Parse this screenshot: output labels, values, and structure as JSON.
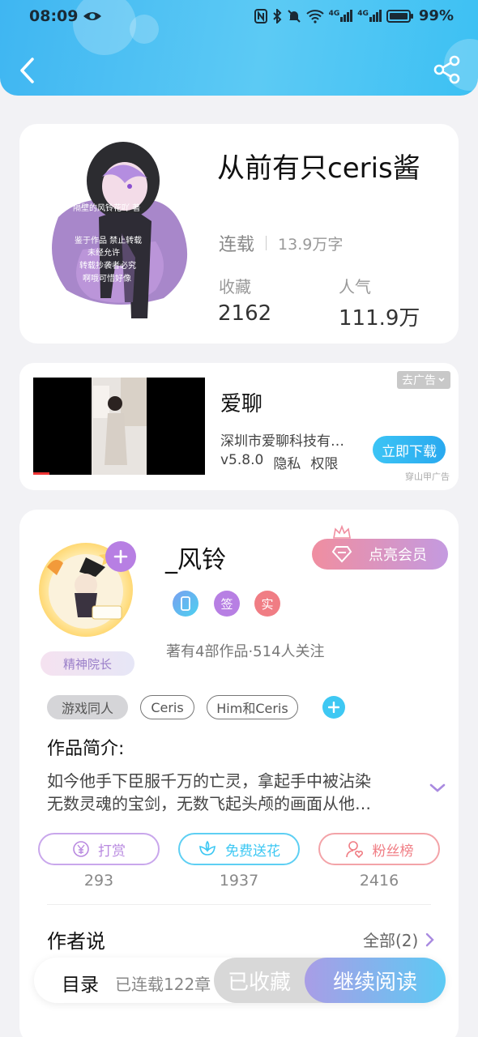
{
  "status_bar": {
    "time": "08:09",
    "battery": "99%",
    "network_1": "4G",
    "network_2": "4G"
  },
  "header": {
    "back_icon": "chevron-left-icon",
    "share_icon": "share-icon"
  },
  "book": {
    "title": "从前有只ceris酱",
    "status": "连载",
    "word_count": "13.9万字",
    "favorites_label": "收藏",
    "favorites_value": "2162",
    "popularity_label": "人气",
    "popularity_value": "111.9万",
    "cover_caption_1": "隔壁的风铃花吖 著",
    "cover_caption_2": "鉴于作品 禁止转载",
    "cover_caption_3": "未经允许",
    "cover_caption_4": "转载抄袭者必究",
    "cover_caption_5": "啊哦可惜好像"
  },
  "ad": {
    "app_name": "爱聊",
    "company": "深圳市爱聊科技有…",
    "version": "v5.8.0",
    "privacy": "隐私",
    "permissions": "权限",
    "close_label": "去广告",
    "download_label": "立即下载",
    "source": "穿山甲广告"
  },
  "author": {
    "name": "_风铃",
    "title_badge": "精神院长",
    "vip_label": "点亮会员",
    "badge_sign": "签",
    "badge_real": "实",
    "works_info": "著有4部作品·514人关注",
    "colors": {
      "vip": "#f08ea0",
      "sign": "#b77fe3",
      "real": "#f07d84"
    }
  },
  "tags": [
    "游戏同人",
    "Ceris",
    "Him和Ceris"
  ],
  "intro": {
    "heading": "作品简介:",
    "text_line1": "如今他手下臣服千万的亡灵，拿起手中被沾染",
    "text_line2": "无数灵魂的宝剑，无数飞起头颅的画面从他…"
  },
  "actions": [
    {
      "label": "打赏",
      "count": "293",
      "icon": "yen-coin-icon",
      "color": "#b98ae0"
    },
    {
      "label": "免费送花",
      "count": "1937",
      "icon": "flower-icon",
      "color": "#3ec8f3"
    },
    {
      "label": "粉丝榜",
      "count": "2416",
      "icon": "user-heart-icon",
      "color": "#f07d84"
    }
  ],
  "author_says": {
    "heading": "作者说",
    "all_label": "全部(2)"
  },
  "bottom": {
    "toc_label": "目录",
    "toc_sub": "已连载122章",
    "favorited_label": "已收藏",
    "continue_label": "继续阅读"
  }
}
